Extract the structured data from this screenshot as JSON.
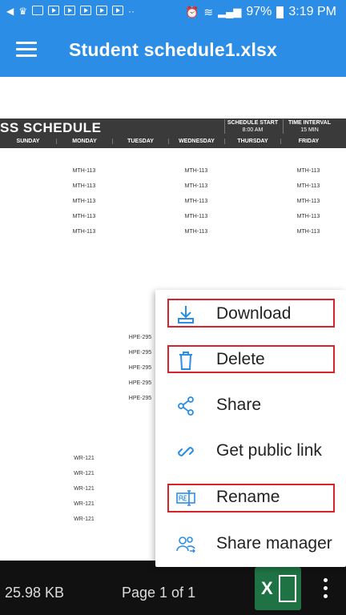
{
  "status_bar": {
    "battery": "97%",
    "time": "3:19 PM"
  },
  "app_bar": {
    "title": "Student schedule1.xlsx"
  },
  "sheet": {
    "title": "SS SCHEDULE",
    "schedule_start_label": "SCHEDULE START",
    "schedule_start_value": "8:00 AM",
    "time_interval_label": "TIME INTERVAL",
    "time_interval_value": "15 MIN",
    "days": [
      "SUNDAY",
      "MONDAY",
      "TUESDAY",
      "WEDNESDAY",
      "THURSDAY",
      "FRIDAY"
    ],
    "mth": "MTH-113",
    "hpe": "HPE-295",
    "wr": "WR-121"
  },
  "menu": {
    "items": [
      {
        "label": "Download",
        "icon": "download-icon"
      },
      {
        "label": "Delete",
        "icon": "trash-icon"
      },
      {
        "label": "Share",
        "icon": "share-icon"
      },
      {
        "label": "Get public link",
        "icon": "link-icon"
      },
      {
        "label": "Rename",
        "icon": "rename-icon"
      },
      {
        "label": "Share manager",
        "icon": "share-manager-icon"
      }
    ]
  },
  "bottom_bar": {
    "file_size": "25.98 KB",
    "page": "Page 1 of 1"
  },
  "colors": {
    "accent": "#2c8de6",
    "highlight": "#d9232c",
    "excel": "#1f7244"
  }
}
